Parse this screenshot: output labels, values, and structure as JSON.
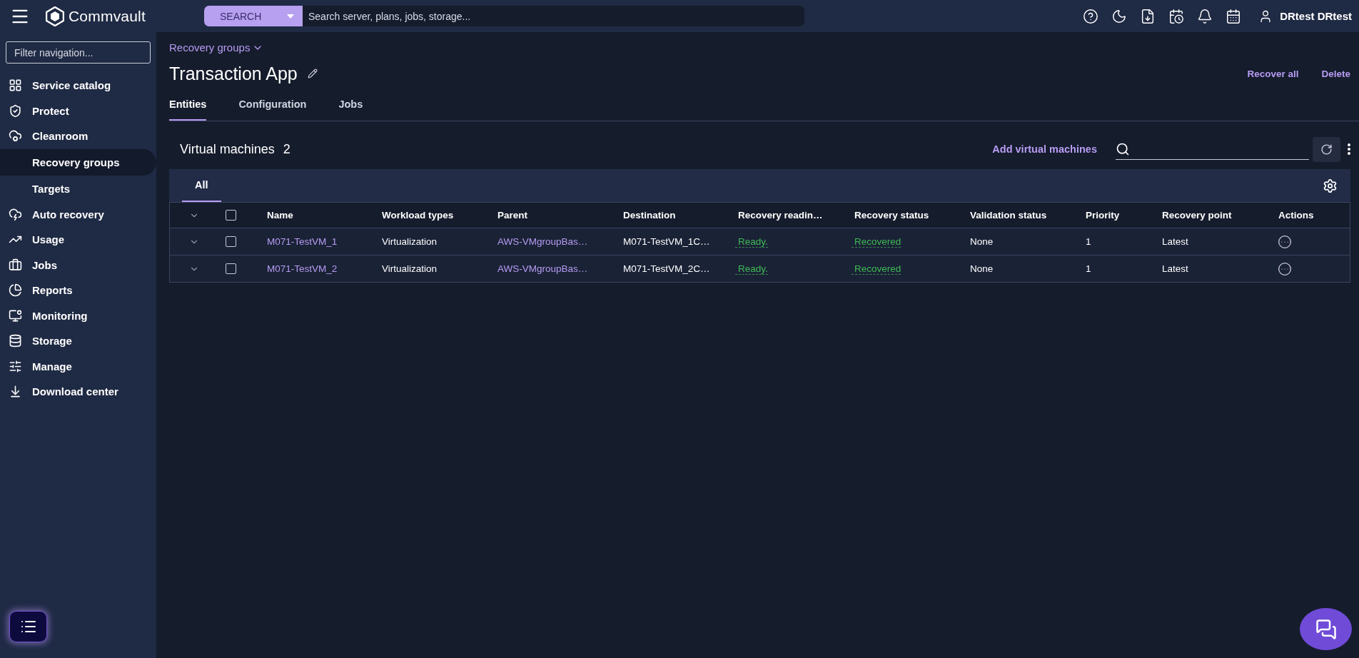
{
  "top_bar": {
    "brand": "Commvault",
    "search_scope": "SEARCH",
    "search_placeholder": "Search server, plans, jobs, storage...",
    "user": "DRtest DRtest"
  },
  "sidebar": {
    "filter_placeholder": "Filter navigation...",
    "items": [
      {
        "label": "Service catalog",
        "selected": false
      },
      {
        "label": "Protect",
        "selected": false
      },
      {
        "label": "Cleanroom",
        "selected": false,
        "children": [
          {
            "label": "Recovery groups",
            "selected": true
          },
          {
            "label": "Targets",
            "selected": false
          }
        ]
      },
      {
        "label": "Auto recovery",
        "selected": false
      },
      {
        "label": "Usage",
        "selected": false
      },
      {
        "label": "Jobs",
        "selected": false
      },
      {
        "label": "Reports",
        "selected": false
      },
      {
        "label": "Monitoring",
        "selected": false
      },
      {
        "label": "Storage",
        "selected": false
      },
      {
        "label": "Manage",
        "selected": false
      },
      {
        "label": "Download center",
        "selected": false
      }
    ]
  },
  "page": {
    "breadcrumb": "Recovery groups",
    "title": "Transaction App",
    "actions": [
      "Recover all",
      "Delete"
    ],
    "tabs": [
      {
        "label": "Entities",
        "selected": true
      },
      {
        "label": "Configuration",
        "selected": false
      },
      {
        "label": "Jobs",
        "selected": false
      }
    ]
  },
  "section": {
    "title": "Virtual machines",
    "count": "2",
    "add_action": "Add virtual machines",
    "view_tabs": [
      {
        "label": "All",
        "selected": true
      }
    ]
  },
  "table": {
    "all_checked": false,
    "columns": [
      "Name",
      "Workload types",
      "Parent",
      "Destination",
      "Recovery readin…",
      "Recovery status",
      "Validation status",
      "Priority",
      "Recovery point",
      "Actions"
    ],
    "rows": [
      {
        "expanded": false,
        "checked": false,
        "cells": [
          "M071-TestVM_1",
          "Virtualization",
          "AWS-VMgroupBas…",
          "M071-TestVM_1C…",
          "Ready.",
          "Recovered",
          "None",
          "1",
          "Latest"
        ]
      },
      {
        "expanded": false,
        "checked": false,
        "cells": [
          "M071-TestVM_2",
          "Virtualization",
          "AWS-VMgroupBas…",
          "M071-TestVM_2C…",
          "Ready.",
          "Recovered",
          "None",
          "1",
          "Latest"
        ]
      }
    ]
  }
}
